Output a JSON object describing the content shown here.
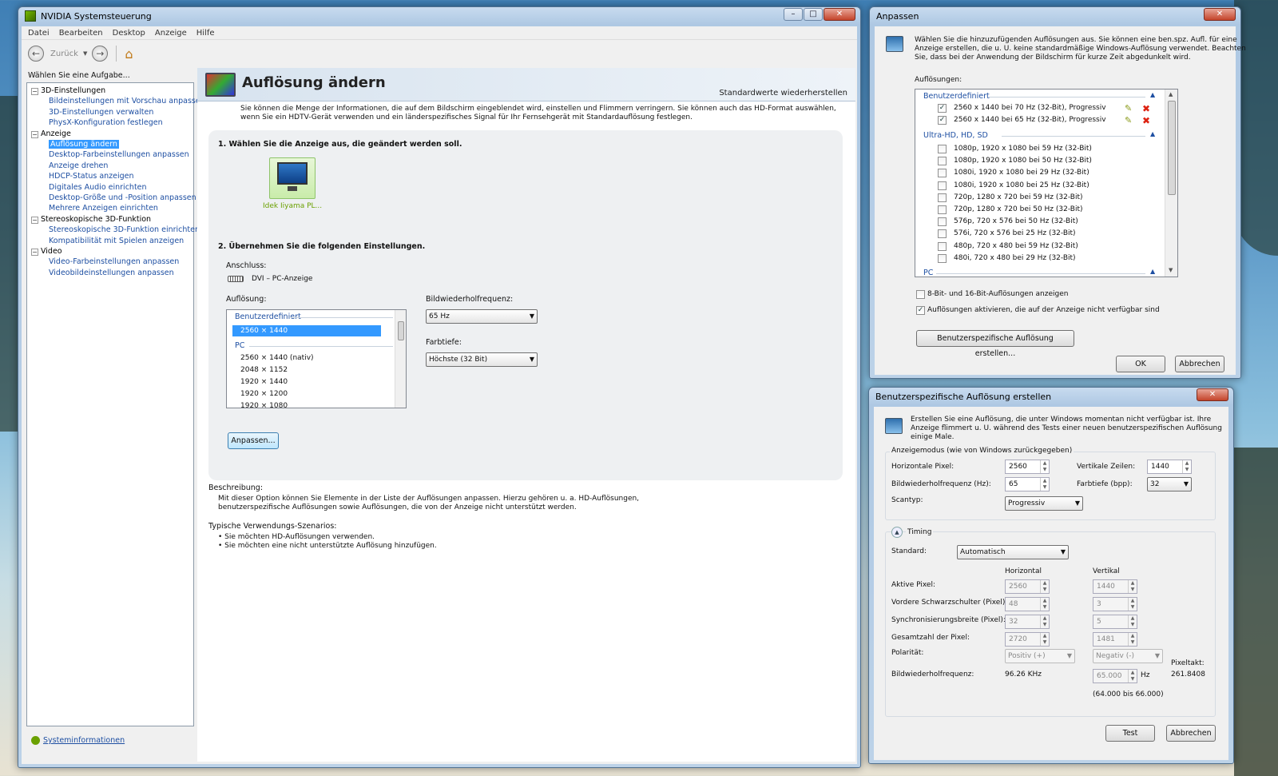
{
  "nvcp": {
    "title": "NVIDIA Systemsteuerung",
    "menu": [
      "Datei",
      "Bearbeiten",
      "Desktop",
      "Anzeige",
      "Hilfe"
    ],
    "back_label": "Zurück",
    "task_prompt": "Wählen Sie eine Aufgabe...",
    "tree": [
      {
        "label": "3D-Einstellungen",
        "kind": "head"
      },
      {
        "label": "Bildeinstellungen mit Vorschau anpassen",
        "kind": "link"
      },
      {
        "label": "3D-Einstellungen verwalten",
        "kind": "link"
      },
      {
        "label": "PhysX-Konfiguration festlegen",
        "kind": "link"
      },
      {
        "label": "Anzeige",
        "kind": "head"
      },
      {
        "label": "Auflösung ändern",
        "kind": "sel"
      },
      {
        "label": "Desktop-Farbeinstellungen anpassen",
        "kind": "link"
      },
      {
        "label": "Anzeige drehen",
        "kind": "link"
      },
      {
        "label": "HDCP-Status anzeigen",
        "kind": "link"
      },
      {
        "label": "Digitales Audio einrichten",
        "kind": "link"
      },
      {
        "label": "Desktop-Größe und -Position anpassen",
        "kind": "link"
      },
      {
        "label": "Mehrere Anzeigen einrichten",
        "kind": "link"
      },
      {
        "label": "Stereoskopische 3D-Funktion",
        "kind": "head"
      },
      {
        "label": "Stereoskopische 3D-Funktion einrichten",
        "kind": "link"
      },
      {
        "label": "Kompatibilität mit Spielen anzeigen",
        "kind": "link"
      },
      {
        "label": "Video",
        "kind": "head"
      },
      {
        "label": "Video-Farbeinstellungen anpassen",
        "kind": "link"
      },
      {
        "label": "Videobildeinstellungen anpassen",
        "kind": "link"
      }
    ],
    "sysinfo": "Systeminformationen",
    "page_title": "Auflösung ändern",
    "restore": "Standardwerte wiederherstellen",
    "intro": "Sie können die Menge der Informationen, die auf dem Bildschirm eingeblendet wird, einstellen und Flimmern verringern. Sie können auch das HD-Format auswählen, wenn Sie ein HDTV-Gerät verwenden und ein länderspezifisches Signal für Ihr Fernsehgerät mit Standardauflösung festlegen.",
    "step1": "1. Wählen Sie die Anzeige aus, die geändert werden soll.",
    "display_name": "Idek Iiyama PL...",
    "step2": "2. Übernehmen Sie die folgenden Einstellungen.",
    "connection_label": "Anschluss:",
    "connection_value": "DVI – PC-Anzeige",
    "resolution_label": "Auflösung:",
    "res_groups": [
      "Benutzerdefiniert",
      "PC"
    ],
    "res_custom": "2560 × 1440",
    "res_pc": [
      "2560 × 1440 (nativ)",
      "2048 × 1152",
      "1920 × 1440",
      "1920 × 1200",
      "1920 × 1080"
    ],
    "refresh_label": "Bildwiederholfrequenz:",
    "refresh_value": "65 Hz",
    "depth_label": "Farbtiefe:",
    "depth_value": "Höchste (32 Bit)",
    "customize_button": "Anpassen...",
    "desc_label": "Beschreibung:",
    "desc_text_1": "Mit dieser Option können Sie Elemente in der Liste der Auflösungen anpassen. Hierzu gehören u. a. HD-Auflösungen,",
    "desc_text_2": "benutzerspezifische Auflösungen sowie Auflösungen, die von der Anzeige nicht unterstützt werden.",
    "scen_label": "Typische Verwendungs-Szenarios:",
    "scenarios": [
      "Sie möchten HD-Auflösungen verwenden.",
      "Sie möchten eine nicht unterstützte Auflösung hinzufügen."
    ]
  },
  "anpassen": {
    "title": "Anpassen",
    "info_1": "Wählen Sie die hinzuzufügenden Auflösungen aus. Sie können eine ben.spz. Aufl. für eine",
    "info_2": "Anzeige erstellen, die u. U. keine standardmäßige Windows-Auflösung verwendet. Beachten",
    "info_3": "Sie, dass bei der Anwendung der Bildschirm für kurze Zeit abgedunkelt wird.",
    "list_label": "Auflösungen:",
    "group_custom": "Benutzerdefiniert",
    "custom_items": [
      {
        "label": "2560 x 1440 bei 70 Hz (32-Bit), Progressiv",
        "checked": "✓"
      },
      {
        "label": "2560 x 1440 bei 65 Hz (32-Bit), Progressiv",
        "checked": "✓"
      }
    ],
    "group_hd": "Ultra-HD, HD, SD",
    "hd_items": [
      "1080p, 1920 x 1080 bei 59 Hz (32-Bit)",
      "1080p, 1920 x 1080 bei 50 Hz (32-Bit)",
      "1080i, 1920 x 1080 bei 29 Hz (32-Bit)",
      "1080i, 1920 x 1080 bei 25 Hz (32-Bit)",
      "720p, 1280 x 720 bei 59 Hz (32-Bit)",
      "720p, 1280 x 720 bei 50 Hz (32-Bit)",
      "576p, 720 x 576 bei 50 Hz (32-Bit)",
      "576i, 720 x 576 bei 25 Hz (32-Bit)",
      "480p, 720 x 480 bei 59 Hz (32-Bit)",
      "480i, 720 x 480 bei 29 Hz (32-Bit)"
    ],
    "group_pc": "PC",
    "opt_8bit": "8-Bit- und 16-Bit-Auflösungen anzeigen",
    "opt_unavail": "Auflösungen aktivieren, die auf der Anzeige nicht verfügbar sind",
    "opt_unavail_check": "✓",
    "create_button": "Benutzerspezifische Auflösung erstellen...",
    "ok": "OK",
    "cancel": "Abbrechen"
  },
  "custom": {
    "title": "Benutzerspezifische Auflösung erstellen",
    "info_1": "Erstellen Sie eine Auflösung, die unter Windows momentan nicht verfügbar ist. Ihre",
    "info_2": "Anzeige flimmert u. U. während des Tests einer neuen benutzerspezifischen Auflösung",
    "info_3": "einige Male.",
    "mode_group": "Anzeigemodus (wie von Windows zurückgegeben)",
    "hpix_label": "Horizontale Pixel:",
    "hpix": "2560",
    "vlines_label": "Vertikale Zeilen:",
    "vlines": "1440",
    "refresh_label": "Bildwiederholfrequenz (Hz):",
    "refresh": "65",
    "depth_label": "Farbtiefe (bpp):",
    "depth": "32",
    "scan_label": "Scantyp:",
    "scan": "Progressiv",
    "timing_label": "Timing",
    "standard_label": "Standard:",
    "standard": "Automatisch",
    "col_h": "Horizontal",
    "col_v": "Vertikal",
    "rows": [
      {
        "label": "Aktive Pixel:",
        "h": "2560",
        "v": "1440"
      },
      {
        "label": "Vordere Schwarzschulter (Pixel):",
        "h": "48",
        "v": "3"
      },
      {
        "label": "Synchronisierungsbreite (Pixel):",
        "h": "32",
        "v": "5"
      },
      {
        "label": "Gesamtzahl der Pixel:",
        "h": "2720",
        "v": "1481"
      }
    ],
    "pol_label": "Polarität:",
    "pol_h": "Positiv (+)",
    "pol_v": "Negativ (-)",
    "freq_label": "Bildwiederholfrequenz:",
    "freq_h": "96.26 KHz",
    "freq_v": "65.000",
    "freq_unit": "Hz",
    "freq_range": "(64.000 bis 66.000)",
    "pixclk_label": "Pixeltakt:",
    "pixclk": "261.8408",
    "test": "Test",
    "cancel": "Abbrechen"
  }
}
